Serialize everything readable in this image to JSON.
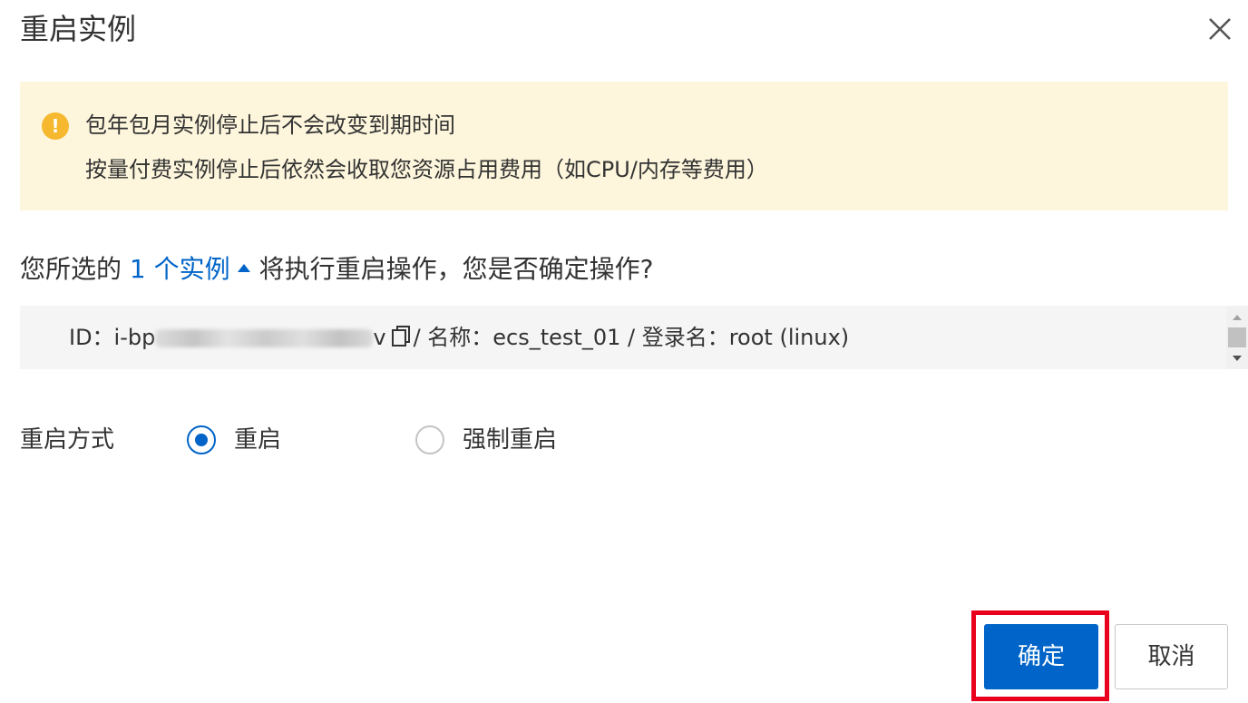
{
  "dialog": {
    "title": "重启实例",
    "close_icon": "close-icon"
  },
  "alert": {
    "icon": "warning-icon",
    "icon_glyph": "!",
    "line1": "包年包月实例停止后不会改变到期时间",
    "line2": "按量付费实例停止后依然会收取您资源占用费用（如CPU/内存等费用）",
    "background": "#fdf6dc",
    "icon_color": "#f5b82e"
  },
  "question": {
    "prefix": "您所选的 ",
    "link_text": "1 个实例",
    "suffix": "将执行重启操作，您是否确定操作?"
  },
  "instance": {
    "id_label": "ID：i-bp",
    "id_tail": "v",
    "separator1": "/ 名称：",
    "name": "ecs_test_01",
    "separator2": " / 登录名：",
    "login": "root (linux)"
  },
  "form": {
    "restart_mode_label": "重启方式",
    "options": [
      {
        "label": "重启",
        "checked": true
      },
      {
        "label": "强制重启",
        "checked": false
      }
    ]
  },
  "footer": {
    "ok_label": "确定",
    "cancel_label": "取消"
  },
  "colors": {
    "accent": "#0064c8",
    "highlight": "#e8001c"
  }
}
